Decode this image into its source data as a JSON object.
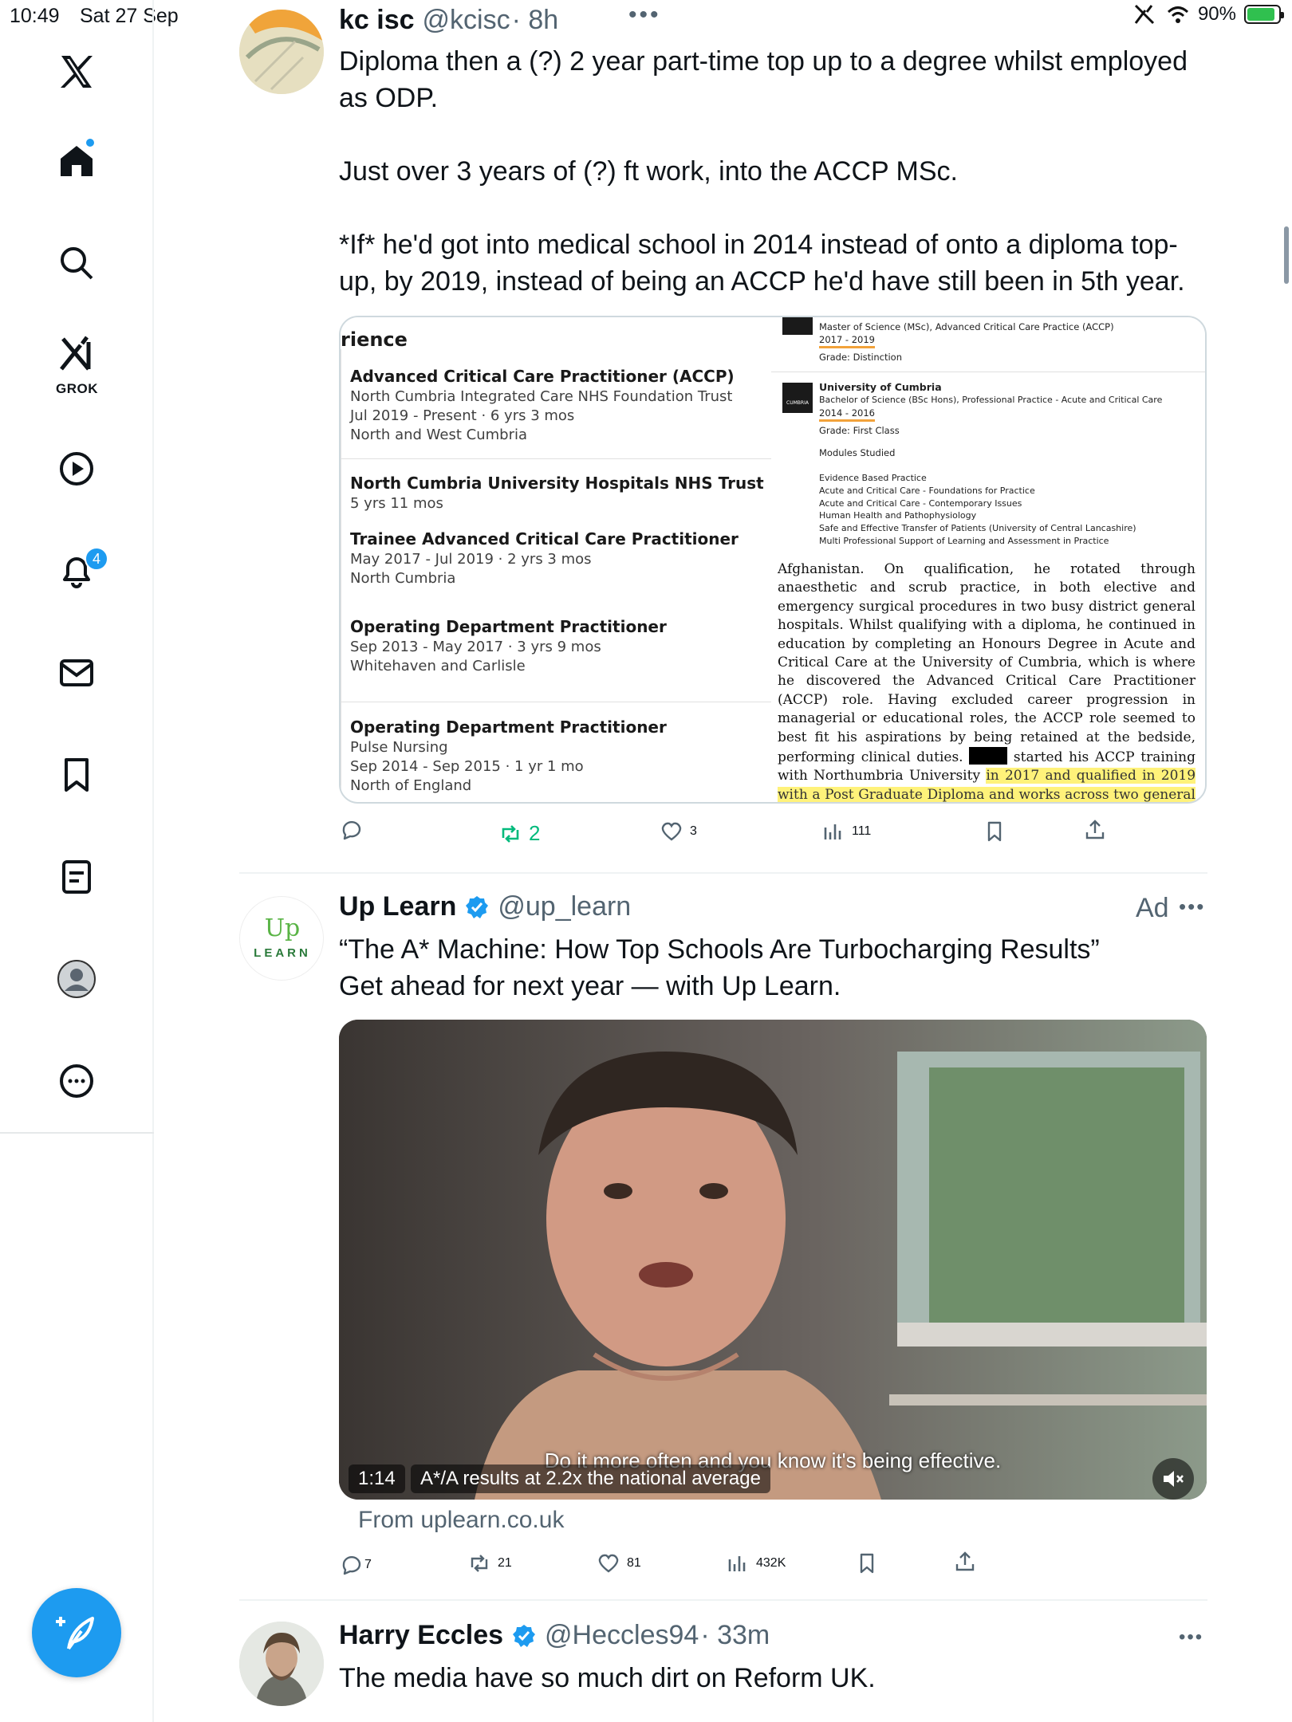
{
  "status_bar": {
    "time": "10:49",
    "date": "Sat 27 Sep",
    "battery": "90%",
    "battery_level": 0.9
  },
  "sidebar": {
    "grok_label": "GROK",
    "notifications_badge": "4",
    "items": [
      "x-logo",
      "home",
      "search",
      "grok",
      "videos",
      "notifications",
      "messages",
      "bookmarks",
      "lists",
      "profile",
      "more"
    ]
  },
  "tweets": [
    {
      "name": "kc isc",
      "handle": "@kcisc",
      "time": "· 8h",
      "text": "Diploma then a (?) 2 year part-time top up to a degree whilst employed\nas ODP.\n\nJust over 3 years of (?) ft work, into the ACCP MSc.\n\n*If* he'd got into medical school in 2014 instead of onto a diploma top-\nup, by 2019, instead of being an ACCP he'd have still been in 5th year.",
      "image": {
        "experience_title": "rience",
        "experience": [
          {
            "title": "Advanced Critical Care Practitioner (ACCP)",
            "lines": [
              "North Cumbria Integrated Care NHS Foundation Trust",
              "Jul 2019 - Present · 6 yrs 3 mos",
              "North and West Cumbria"
            ]
          },
          {
            "title": "North Cumbria University Hospitals NHS Trust",
            "lines": [
              "5 yrs 11 mos"
            ]
          },
          {
            "title": "Trainee Advanced Critical Care Practitioner",
            "lines": [
              "May 2017 - Jul 2019 · 2 yrs 3 mos",
              "North Cumbria"
            ]
          },
          {
            "title": "Operating Department Practitioner",
            "lines": [
              "Sep 2013 - May 2017 · 3 yrs 9 mos",
              "Whitehaven and Carlisle"
            ]
          },
          {
            "title": "Operating Department Practitioner",
            "lines": [
              "Pulse Nursing",
              "Sep 2014 - Sep 2015 · 1 yr 1 mo",
              "North of England"
            ]
          }
        ],
        "education": {
          "msc_degree": "Master of Science (MSc), Advanced Critical Care Practice (ACCP)",
          "msc_years": "2017 - 2019",
          "msc_grade": "Grade: Distinction",
          "uni": "University of Cumbria",
          "logo_text": "CUMBRIA",
          "bsc_degree": "Bachelor of Science (BSc Hons), Professional Practice - Acute and Critical Care",
          "bsc_years": "2014 - 2016",
          "bsc_grade": "Grade: First Class",
          "modules_title": "Modules Studied",
          "modules": [
            "Evidence Based Practice",
            "Acute and Critical Care - Foundations for Practice",
            "Acute and Critical Care - Contemporary Issues",
            "Human Health and Pathophysiology",
            "Safe and Effective Transfer of Patients (University of Central Lancashire)",
            "Multi Professional Support of Learning and Assessment in Practice"
          ]
        },
        "scan_text": "Afghanistan. On qualification, he rotated through anaesthetic and scrub practice, in both elective and emergency surgical procedures in two busy district general hospitals. Whilst qualifying with a diploma, he continued in education by completing an Honours Degree in Acute and Critical Care at the University of Cumbria, which is where he discovered the Advanced Critical Care Practitioner (ACCP) role. Having excluded career progression in managerial or educational roles, the ACCP role seemed to best fit his aspirations by being retained at the bedside, performing clinical duties.",
        "scan_text_2": "started his ACCP training with Northumbria University",
        "scan_highlight": "in 2017 and qualified in 2019 with a Post Graduate Diploma and works across two general intensive care units, which"
      },
      "stats": {
        "replies": "",
        "reposts": "2",
        "likes": "3",
        "views": "111"
      }
    },
    {
      "name": "Up Learn",
      "handle": "@up_learn",
      "ad_label": "Ad",
      "avatar_text_top": "Up",
      "avatar_text_bottom": "LEARN",
      "text": "“The A* Machine: How Top Schools Are Turbocharging Results”\nGet ahead for next year — with Up Learn.",
      "video": {
        "subtitle": "Do it more often and you know it's being effective.",
        "duration": "1:14",
        "caption": "A*/A results at 2.2x the national average"
      },
      "source": "From uplearn.co.uk",
      "stats": {
        "replies": "7",
        "reposts": "21",
        "likes": "81",
        "views": "432K"
      }
    },
    {
      "name": "Harry Eccles",
      "handle": "@Heccles94",
      "time": "· 33m",
      "text": "The media have so much dirt on Reform UK."
    }
  ],
  "colors": {
    "accent": "#1d9bf0",
    "repost_active": "#00ba7c",
    "text": "#0f1419",
    "muted": "#536471",
    "highlight": "#fff27a",
    "underline": "#f2a23a"
  }
}
